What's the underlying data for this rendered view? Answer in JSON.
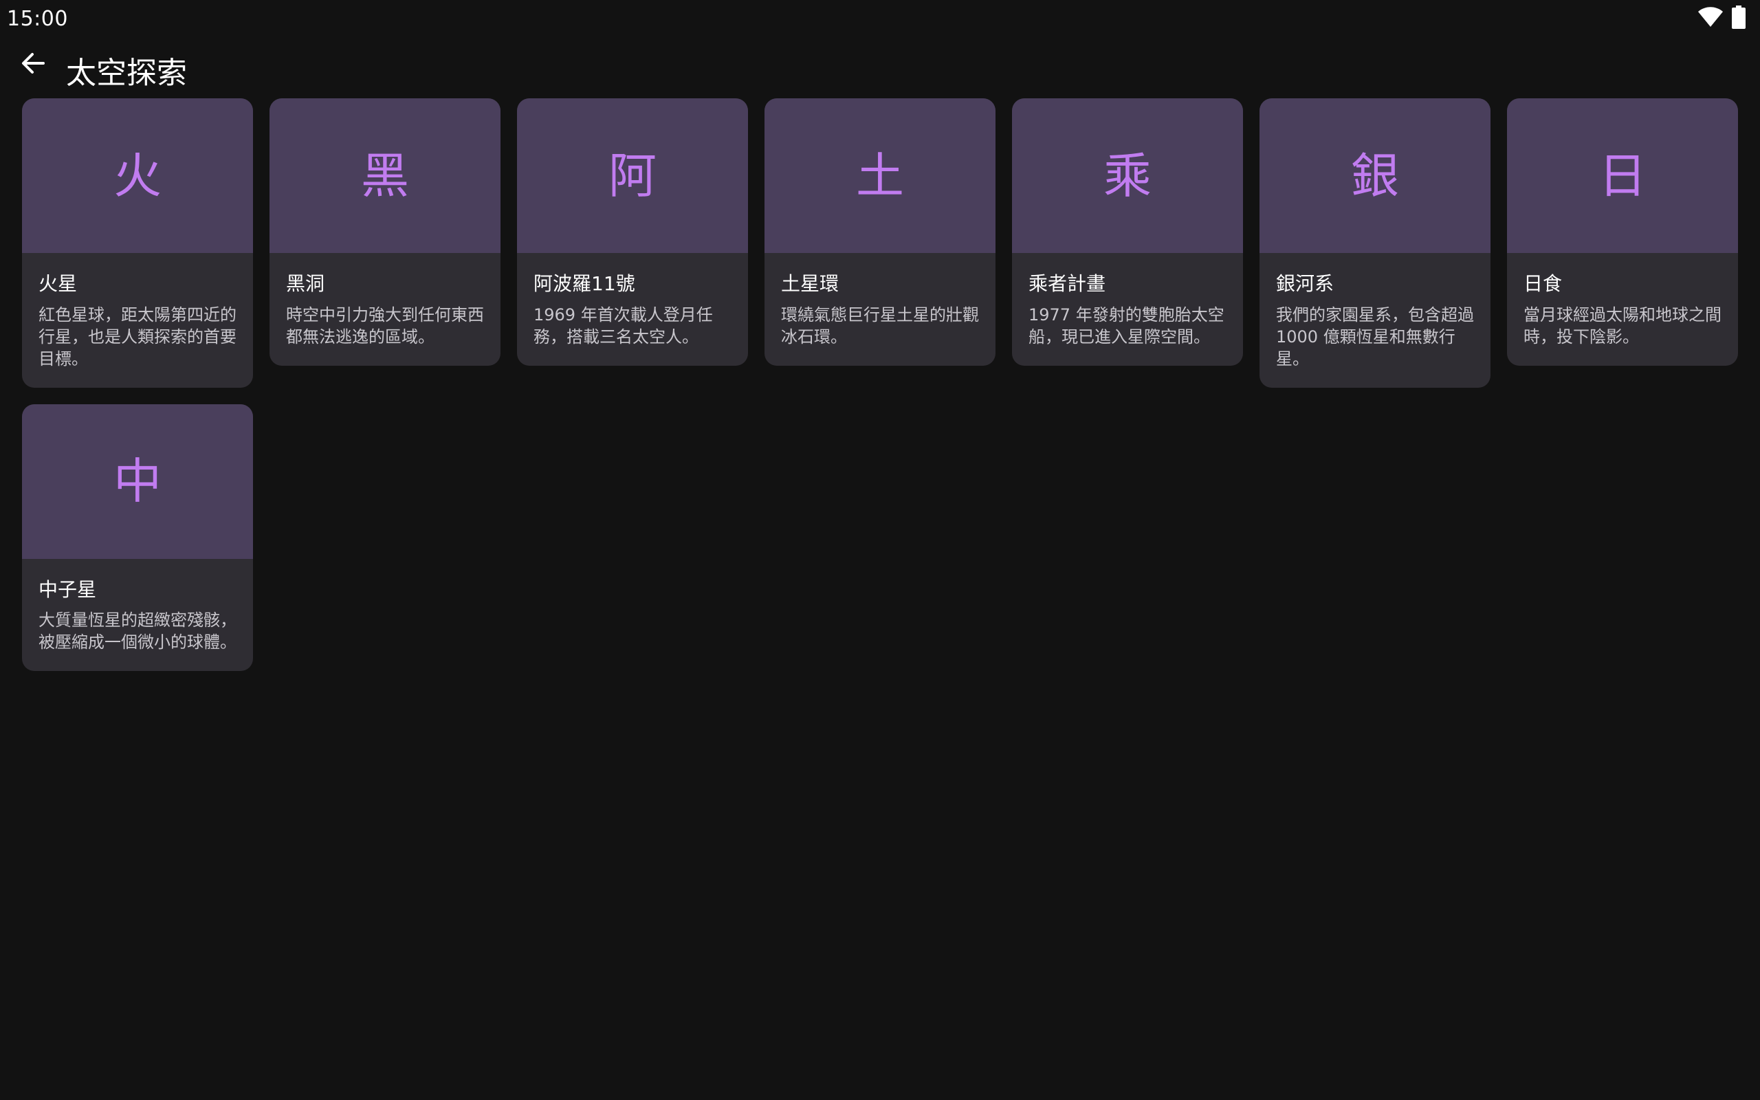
{
  "status_bar": {
    "time": "15:00",
    "icons": [
      "wifi-icon",
      "battery-icon"
    ]
  },
  "app_bar": {
    "back_icon": "arrow-back-icon",
    "title": "太空探索"
  },
  "colors": {
    "background": "#121212",
    "card": "#2f2d33",
    "card_hero": "#4a3f5c",
    "accent": "#c17cf0"
  },
  "cards": [
    {
      "initial": "火",
      "title": "火星",
      "description": "紅色星球，距太陽第四近的行星，也是人類探索的首要目標。"
    },
    {
      "initial": "黑",
      "title": "黑洞",
      "description": "時空中引力強大到任何東西都無法逃逸的區域。"
    },
    {
      "initial": "阿",
      "title": "阿波羅11號",
      "description": "1969 年首次載人登月任務，搭載三名太空人。"
    },
    {
      "initial": "土",
      "title": "土星環",
      "description": "環繞氣態巨行星土星的壯觀冰石環。"
    },
    {
      "initial": "乘",
      "title": "乘者計畫",
      "description": "1977 年發射的雙胞胎太空船，現已進入星際空間。"
    },
    {
      "initial": "銀",
      "title": "銀河系",
      "description": "我們的家園星系，包含超過 1000 億顆恆星和無數行星。"
    },
    {
      "initial": "日",
      "title": "日食",
      "description": "當月球經過太陽和地球之間時，投下陰影。"
    },
    {
      "initial": "中",
      "title": "中子星",
      "description": "大質量恆星的超緻密殘骸，被壓縮成一個微小的球體。"
    }
  ]
}
